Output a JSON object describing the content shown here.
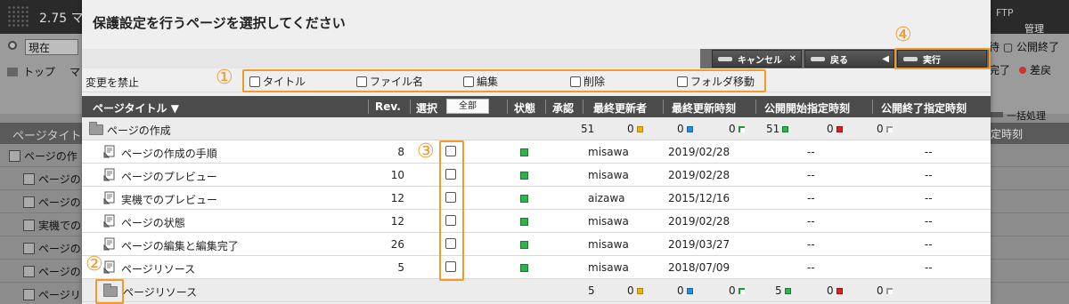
{
  "background": {
    "version": "2.75 マ",
    "select_value": "現在",
    "breadcrumb_top": "トップ",
    "breadcrumb_m": "マ",
    "ftp_label": "FTP",
    "kanri_label": "管理",
    "right_r1": "待 ▢ 公開終了",
    "right_r2_a": "完了",
    "right_r2_b": "差戻",
    "ikkatsu_label": "一括処理",
    "kaiji_label": "定時刻",
    "grid_header": "ページタイト",
    "rows": [
      "ページの作",
      "ページの",
      "ページの",
      "実機での",
      "ページの",
      "ページの",
      "ページリ"
    ]
  },
  "modal": {
    "title": "保護設定を行うページを選択してください",
    "buttons": {
      "cancel": "キャンセル",
      "cancel_tail": "✕",
      "back": "戻る",
      "back_tail": "◀",
      "execute": "実行"
    },
    "prohibit_label": "変更を禁止",
    "prohibit_options": [
      "タイトル",
      "ファイル名",
      "編集",
      "削除",
      "フォルダ移動"
    ],
    "columns": {
      "title": "ページタイトル ▼",
      "rev": "Rev.",
      "select": "選択",
      "select_all": "全部",
      "state": "状態",
      "approve": "承認",
      "updater": "最終更新者",
      "updated": "最終更新時刻",
      "pub_start": "公開開始指定時刻",
      "pub_end": "公開終了指定時刻"
    },
    "group1": {
      "name": "ページの作成",
      "total": "51",
      "counts": [
        "0",
        "0",
        "0",
        "51",
        "0",
        "0"
      ]
    },
    "pages": [
      {
        "title": "ページの作成の手順",
        "rev": "8",
        "updater": "misawa",
        "updated": "2019/02/28",
        "pub_start": "--",
        "pub_end": "--"
      },
      {
        "title": "ページのプレビュー",
        "rev": "10",
        "updater": "misawa",
        "updated": "2019/02/28",
        "pub_start": "--",
        "pub_end": "--"
      },
      {
        "title": "実機でのプレビュー",
        "rev": "12",
        "updater": "aizawa",
        "updated": "2015/12/16",
        "pub_start": "--",
        "pub_end": "--"
      },
      {
        "title": "ページの状態",
        "rev": "12",
        "updater": "misawa",
        "updated": "2019/02/28",
        "pub_start": "--",
        "pub_end": "--"
      },
      {
        "title": "ページの編集と編集完了",
        "rev": "26",
        "updater": "misawa",
        "updated": "2019/03/27",
        "pub_start": "--",
        "pub_end": "--"
      },
      {
        "title": "ページリソース",
        "rev": "5",
        "updater": "misawa",
        "updated": "2018/07/09",
        "pub_start": "--",
        "pub_end": "--"
      }
    ],
    "group2": {
      "name": "ページリソース",
      "total": "5",
      "counts": [
        "0",
        "0",
        "0",
        "5",
        "0",
        "0"
      ]
    }
  },
  "annotations": [
    "①",
    "②",
    "③",
    "④"
  ],
  "colors": {
    "annotation": "#f39a2d",
    "state_green": "#2fb34a",
    "header_dark": "#4b4b4b"
  },
  "icons": {
    "folder": "folder-icon",
    "page": "page-icon",
    "state": "status-green-square"
  }
}
